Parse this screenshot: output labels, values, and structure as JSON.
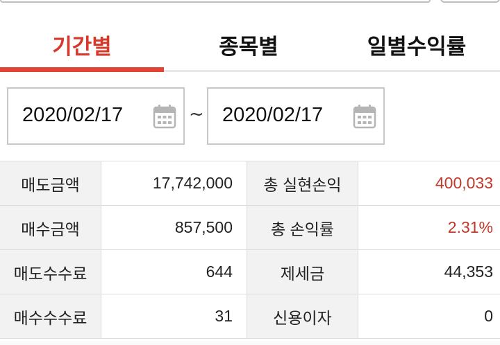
{
  "tabs": [
    {
      "label": "기간별",
      "active": true
    },
    {
      "label": "종목별",
      "active": false
    },
    {
      "label": "일별수익률",
      "active": false
    }
  ],
  "date_range": {
    "start": "2020/02/17",
    "separator": "~",
    "end": "2020/02/17"
  },
  "summary": {
    "rows": [
      {
        "label_left": "매도금액",
        "value_left": "17,742,000",
        "label_right": "총 실현손익",
        "value_right": "400,033"
      },
      {
        "label_left": "매수금액",
        "value_left": "857,500",
        "label_right": "총 손익률",
        "value_right": "2.31%"
      },
      {
        "label_left": "매도수수료",
        "value_left": "644",
        "label_right": "제세금",
        "value_right": "44,353"
      },
      {
        "label_left": "매수수수료",
        "value_left": "31",
        "label_right": "신용이자",
        "value_right": "0"
      }
    ]
  },
  "colors": {
    "accent": "#e04536",
    "active_tab_text": "#d6382b",
    "profit_text": "#c0392b",
    "label_bg": "#f2f2f2"
  }
}
